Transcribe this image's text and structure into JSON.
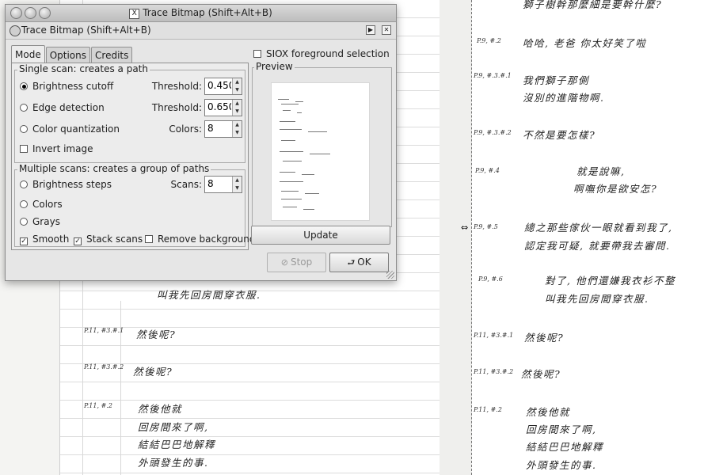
{
  "window": {
    "wm_title": "Trace Bitmap (Shift+Alt+B)",
    "dock_title": "Trace Bitmap (Shift+Alt+B)",
    "wm_x_glyph": "X"
  },
  "tabs": [
    {
      "label": "Mode",
      "active": true
    },
    {
      "label": "Options",
      "active": false
    },
    {
      "label": "Credits",
      "active": false
    }
  ],
  "single_scan": {
    "legend": "Single scan: creates a path",
    "brightness": {
      "label": "Brightness cutoff",
      "selected": true,
      "param_label": "Threshold:",
      "value": "0.450"
    },
    "edge": {
      "label": "Edge detection",
      "selected": false,
      "param_label": "Threshold:",
      "value": "0.650"
    },
    "color": {
      "label": "Color quantization",
      "selected": false,
      "param_label": "Colors:",
      "value": "8"
    },
    "invert": {
      "label": "Invert image",
      "checked": false
    }
  },
  "multi_scan": {
    "legend": "Multiple scans: creates a group of paths",
    "brightness_steps": {
      "label": "Brightness steps",
      "selected": false,
      "param_label": "Scans:",
      "value": "8"
    },
    "colors": {
      "label": "Colors",
      "selected": false
    },
    "grays": {
      "label": "Grays",
      "selected": false
    },
    "smooth": {
      "label": "Smooth",
      "checked": true
    },
    "stack": {
      "label": "Stack scans",
      "checked": true
    },
    "remove_bg": {
      "label": "Remove background",
      "checked": false
    }
  },
  "siox": {
    "label": "SIOX foreground selection",
    "checked": false
  },
  "preview": {
    "legend": "Preview",
    "update_label": "Update"
  },
  "buttons": {
    "stop": "Stop",
    "ok": "OK"
  },
  "background": {
    "left_lines": [
      {
        "text": "叫我先回房間穿衣服.",
        "ref": ""
      },
      {
        "text": "然後呢?",
        "ref": "P.11, #3.#.1"
      },
      {
        "text": "然後呢?",
        "ref": "P.11, #3.#.2"
      },
      {
        "text": "然後他就",
        "ref": "P.11, #.2"
      },
      {
        "text": "回房間來了啊,",
        "ref": ""
      },
      {
        "text": "結結巴巴地解釋",
        "ref": ""
      },
      {
        "text": "外頭發生的事.",
        "ref": ""
      }
    ],
    "right_lines": [
      {
        "text": "獅子樹幹那麼細是要幹什麼?",
        "ref": ""
      },
      {
        "text": "哈哈, 老爸   你太好笑了啦",
        "ref": "P.9, #.2"
      },
      {
        "text": "我們獅子那側",
        "ref": "P.9, #.3.#.1"
      },
      {
        "text": "沒別的進階物啊.",
        "ref": ""
      },
      {
        "text": "不然是要怎樣?",
        "ref": "P.9, #.3.#.2"
      },
      {
        "text": "就是說嘛,",
        "ref": "P.9, #.4"
      },
      {
        "text": "啊嘸你是欲安怎?",
        "ref": ""
      },
      {
        "text": "總之那些傢伙一眼就看到我了,",
        "ref": "P.9, #.5"
      },
      {
        "text": "認定我可疑, 就要帶我去審問.",
        "ref": ""
      },
      {
        "text": "對了, 他們還嫌我衣衫不整",
        "ref": "P.9, #.6"
      },
      {
        "text": "叫我先回房間穿衣服.",
        "ref": ""
      },
      {
        "text": "然後呢?",
        "ref": "P.11, #3.#.1"
      },
      {
        "text": "然後呢?",
        "ref": "P.11, #3.#.2"
      },
      {
        "text": "然後他就",
        "ref": "P.11, #.2"
      },
      {
        "text": "回房間來了啊,",
        "ref": ""
      },
      {
        "text": "結結巴巴地解釋",
        "ref": ""
      },
      {
        "text": "外頭發生的事.",
        "ref": ""
      }
    ]
  }
}
